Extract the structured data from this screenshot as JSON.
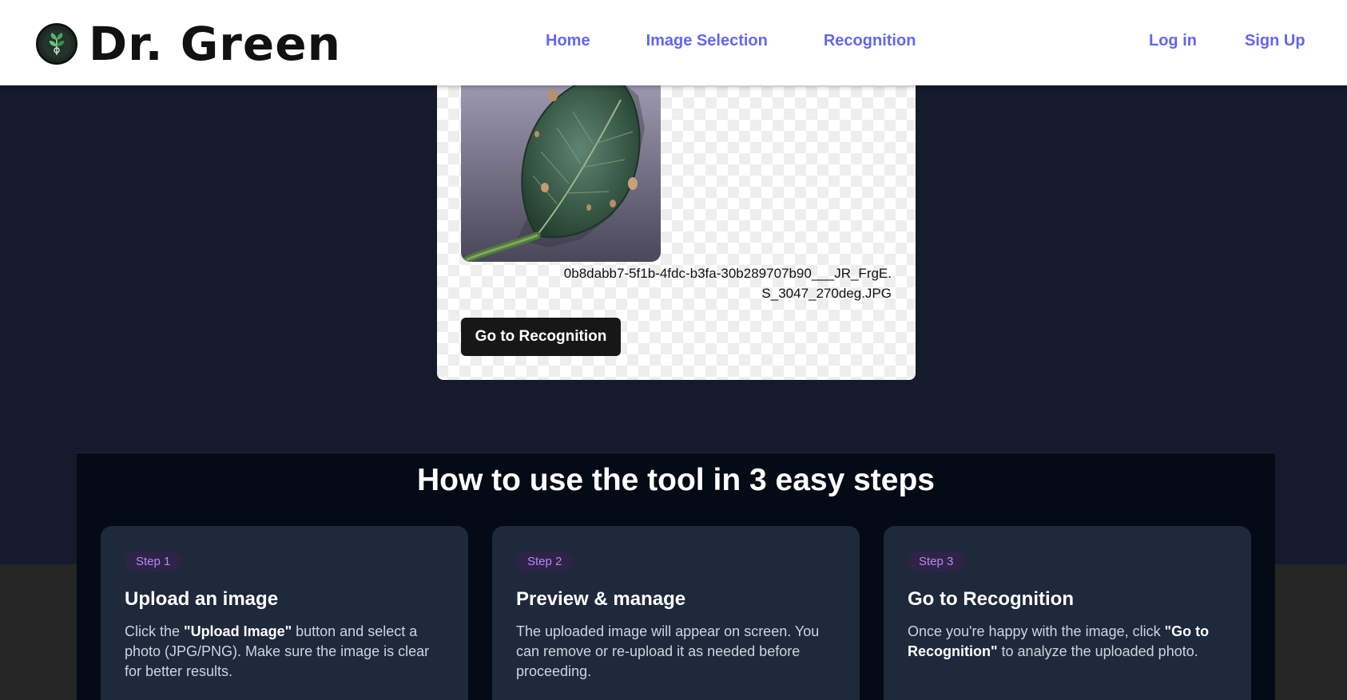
{
  "header": {
    "brand": "Dr. Green",
    "nav": [
      "Home",
      "Image Selection",
      "Recognition"
    ],
    "login": "Log in",
    "signup": "Sign Up"
  },
  "preview": {
    "file_name": "0b8dabb7-5f1b-4fdc-b3fa-30b289707b90___JR_FrgE.S_3047_270deg.JPG",
    "button_label": "Go to Recognition"
  },
  "steps": {
    "heading": "How to use the tool in 3 easy steps",
    "items": [
      {
        "badge": "Step 1",
        "title": "Upload an image",
        "desc_pre": "Click the ",
        "desc_bold": "\"Upload Image\"",
        "desc_post": " button and select a photo (JPG/PNG). Make sure the image is clear for better results."
      },
      {
        "badge": "Step 2",
        "title": "Preview & manage",
        "desc_pre": "The uploaded image will appear on screen. You can remove or re-upload it as needed before proceeding.",
        "desc_bold": "",
        "desc_post": ""
      },
      {
        "badge": "Step 3",
        "title": "Go to Recognition",
        "desc_pre": "Once you're happy with the image, click ",
        "desc_bold": "\"Go to Recognition\"",
        "desc_post": " to analyze the uploaded photo."
      }
    ]
  },
  "colors": {
    "accent": "#6366f1",
    "page_bg": "#131b2c",
    "step_badge": "#b987f5"
  }
}
